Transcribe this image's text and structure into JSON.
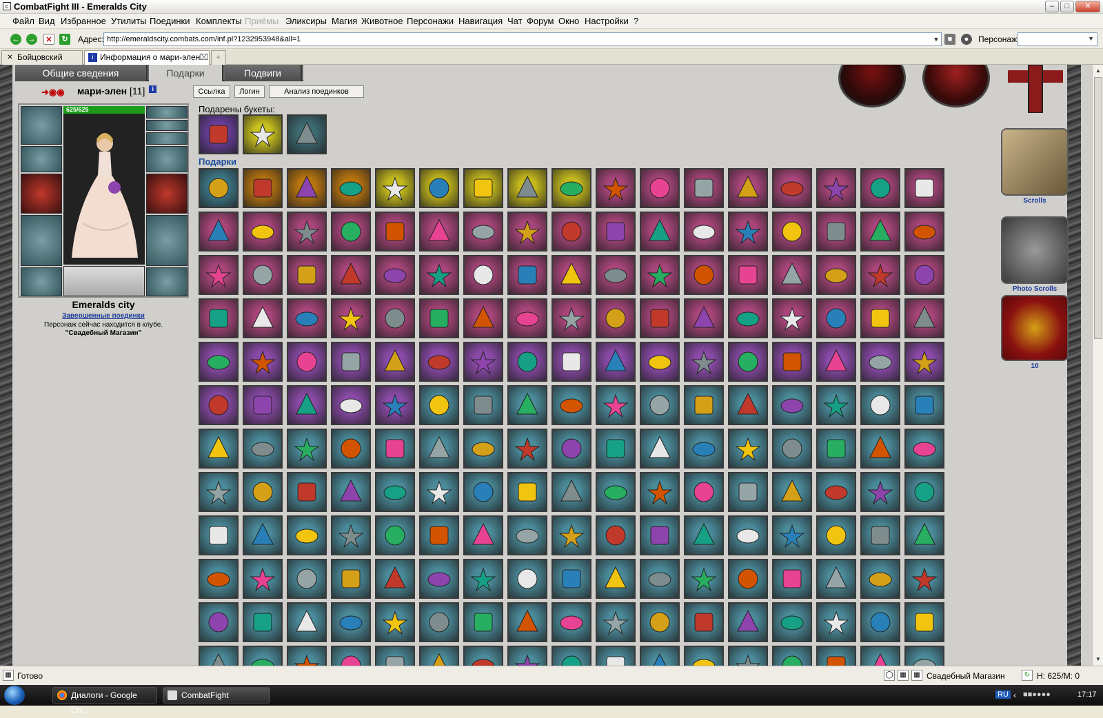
{
  "window": {
    "title": "CombatFight III - Emeralds City",
    "app_icon": "c"
  },
  "menu": {
    "items": [
      "Файл",
      "Вид",
      "Избранное",
      "Утилиты",
      "Поединки",
      "Комплекты",
      "Приёмы",
      "Эликсиры",
      "Магия",
      "Животное",
      "Персонажи",
      "Навигация",
      "Чат",
      "Форум",
      "Окно",
      "Настройки",
      "?"
    ],
    "disabled": [
      "Приёмы"
    ]
  },
  "address": {
    "label": "Адрес:",
    "url": "http://emeraldscity.combats.com/inf.pl?1232953948&all=1",
    "persona_label": "Персонаж:"
  },
  "browser_tabs": [
    {
      "label": "Бойцовский клуб",
      "active": false
    },
    {
      "label": "Информация о мари-элен",
      "active": true
    }
  ],
  "nav_tabs": [
    {
      "label": "Общие сведения",
      "active": false
    },
    {
      "label": "Подарки",
      "active": true
    },
    {
      "label": "Подвиги",
      "active": false
    }
  ],
  "character": {
    "name": "мари-элен",
    "level": "[11]",
    "info_icon": "i",
    "hp": "625/625",
    "city": "Emeralds city",
    "finished_battles": "Завершенные поединки",
    "location_line1": "Персонаж сейчас находится в клубе.",
    "location_line2": "\"Свадебный Магазин\""
  },
  "action_buttons": {
    "link": "Ссылка",
    "login": "Логин",
    "analysis": "Анализ поединков"
  },
  "bouquets_label": "Подарены букеты:",
  "gifts_label": "Подарки",
  "right_panel": {
    "scrolls": "Scrolls",
    "photo_scrolls": "Photo Scrolls",
    "count": "10"
  },
  "status": {
    "text": "Готово",
    "location": "Свадебный Магазин",
    "hp": "H: 625/M: 0"
  },
  "taskbar": {
    "items": [
      "Диалоги - Google Ch...",
      "CombatFight"
    ],
    "lang": "RU",
    "clock": "17:17"
  },
  "gift_palette": {
    "bouquets": [
      "#6b3fa0",
      "#c9c21e",
      "#3d6b73"
    ],
    "rows": [
      [
        "#3d7a8a",
        "#b8740f",
        "#b8740f",
        "#b8740f",
        "#c3b81c",
        "#c3b81c",
        "#c3b81c",
        "#c3b81c",
        "#c3b81c",
        "#a8457a",
        "#a8457a",
        "#a8457a",
        "#a8457a",
        "#a8457a",
        "#a8457a",
        "#a8457a",
        "#a8457a"
      ],
      [
        "#a8457a",
        "#a8457a",
        "#a8457a",
        "#a8457a",
        "#a8457a",
        "#a8457a",
        "#a8457a",
        "#a8457a",
        "#a8457a",
        "#a8457a",
        "#a8457a",
        "#a8457a",
        "#a8457a",
        "#a8457a",
        "#a8457a",
        "#a8457a",
        "#a8457a"
      ],
      [
        "#a8457a",
        "#a8457a",
        "#a8457a",
        "#a8457a",
        "#a8457a",
        "#a8457a",
        "#a8457a",
        "#a8457a",
        "#a8457a",
        "#a8457a",
        "#a8457a",
        "#a8457a",
        "#a8457a",
        "#a8457a",
        "#a8457a",
        "#a8457a",
        "#a8457a"
      ],
      [
        "#a8457a",
        "#a8457a",
        "#a8457a",
        "#a8457a",
        "#a8457a",
        "#a8457a",
        "#a8457a",
        "#a8457a",
        "#a8457a",
        "#a8457a",
        "#a8457a",
        "#a8457a",
        "#a8457a",
        "#a8457a",
        "#a8457a",
        "#a8457a",
        "#a8457a"
      ],
      [
        "#8a4aa8",
        "#8a4aa8",
        "#8a4aa8",
        "#8a4aa8",
        "#8a4aa8",
        "#8a4aa8",
        "#8a4aa8",
        "#8a4aa8",
        "#8a4aa8",
        "#8a4aa8",
        "#8a4aa8",
        "#8a4aa8",
        "#8a4aa8",
        "#8a4aa8",
        "#8a4aa8",
        "#8a4aa8",
        "#8a4aa8"
      ],
      [
        "#8a4aa8",
        "#8a4aa8",
        "#8a4aa8",
        "#8a4aa8",
        "#8a4aa8",
        "#4a8a99",
        "#4a8a99",
        "#4a8a99",
        "#4a8a99",
        "#4a8a99",
        "#4a8a99",
        "#4a8a99",
        "#4a8a99",
        "#4a8a99",
        "#4a8a99",
        "#4a8a99",
        "#4a8a99"
      ],
      [
        "#4a8a99",
        "#4a8a99",
        "#4a8a99",
        "#4a8a99",
        "#4a8a99",
        "#4a8a99",
        "#4a8a99",
        "#4a8a99",
        "#4a8a99",
        "#4a8a99",
        "#4a8a99",
        "#4a8a99",
        "#4a8a99",
        "#4a8a99",
        "#4a8a99",
        "#4a8a99",
        "#4a8a99"
      ],
      [
        "#4a8a99",
        "#4a8a99",
        "#4a8a99",
        "#4a8a99",
        "#4a8a99",
        "#4a8a99",
        "#4a8a99",
        "#4a8a99",
        "#4a8a99",
        "#4a8a99",
        "#4a8a99",
        "#4a8a99",
        "#4a8a99",
        "#4a8a99",
        "#4a8a99",
        "#4a8a99",
        "#4a8a99"
      ],
      [
        "#4a8a99",
        "#4a8a99",
        "#4a8a99",
        "#4a8a99",
        "#4a8a99",
        "#4a8a99",
        "#4a8a99",
        "#4a8a99",
        "#4a8a99",
        "#4a8a99",
        "#4a8a99",
        "#4a8a99",
        "#4a8a99",
        "#4a8a99",
        "#4a8a99",
        "#4a8a99",
        "#4a8a99"
      ],
      [
        "#4a8a99",
        "#4a8a99",
        "#4a8a99",
        "#4a8a99",
        "#4a8a99",
        "#4a8a99",
        "#4a8a99",
        "#4a8a99",
        "#4a8a99",
        "#4a8a99",
        "#4a8a99",
        "#4a8a99",
        "#4a8a99",
        "#4a8a99",
        "#4a8a99",
        "#4a8a99",
        "#4a8a99"
      ],
      [
        "#4a8a99",
        "#4a8a99",
        "#4a8a99",
        "#4a8a99",
        "#4a8a99",
        "#4a8a99",
        "#4a8a99",
        "#4a8a99",
        "#4a8a99",
        "#4a8a99",
        "#4a8a99",
        "#4a8a99",
        "#4a8a99",
        "#4a8a99",
        "#4a8a99",
        "#4a8a99",
        "#4a8a99"
      ],
      [
        "#4a8a99",
        "#4a8a99",
        "#4a8a99",
        "#4a8a99",
        "#4a8a99",
        "#4a8a99",
        "#4a8a99",
        "#4a8a99",
        "#4a8a99",
        "#4a8a99",
        "#4a8a99",
        "#4a8a99",
        "#4a8a99",
        "#4a8a99",
        "#4a8a99",
        "#4a8a99",
        "#4a8a99"
      ]
    ],
    "item_colors": [
      "#d4a017",
      "#c0392b",
      "#8e44ad",
      "#16a085",
      "#e8e8e8",
      "#2980b9",
      "#f1c40f",
      "#7f8c8d",
      "#27ae60",
      "#d35400",
      "#e84393",
      "#95a5a6"
    ]
  }
}
